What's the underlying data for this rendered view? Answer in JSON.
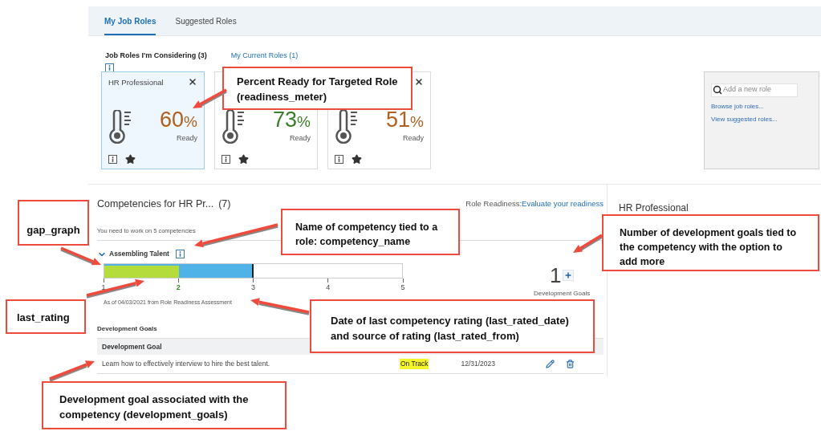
{
  "tabs": [
    {
      "label": "My Job Roles",
      "selected": true
    },
    {
      "label": "Suggested Roles",
      "selected": false
    }
  ],
  "role_lists": [
    {
      "label": "Job Roles I'm Considering (3)",
      "kind": "heading"
    },
    {
      "label": "My Current Roles (1)",
      "kind": "link"
    }
  ],
  "role_cards": [
    {
      "title": "HR Professional",
      "percent": "60",
      "unit": "%",
      "color": "#b0601c",
      "ready": "Ready",
      "selected": true
    },
    {
      "percent": "73",
      "unit": "%",
      "color": "#3b7d2a",
      "ready": "Ready",
      "selected": false
    },
    {
      "percent": "51",
      "unit": "%",
      "color": "#b0601c",
      "ready": "Ready",
      "selected": false
    }
  ],
  "side_panel": {
    "search": {
      "placeholder": "Add a new role"
    },
    "links": [
      "Browse job roles...",
      "View suggested roles..."
    ]
  },
  "competencies": {
    "title": "Competencies for HR Pr...",
    "count": "(7)",
    "readiness_label": "Role Readiness:",
    "readiness_link": "Evaluate your readiness",
    "subtitle": "You need to work on 5 competencies",
    "competency": {
      "name": "Assembling Talent",
      "expanded": true,
      "gap_graph": {
        "rating_bar": {
          "level": 0.25
        },
        "target_bar": {
          "level": 0.5
        },
        "ticks": [
          {
            "label": "1",
            "selected": false
          },
          {
            "label": "2",
            "selected": true
          },
          {
            "label": "3",
            "selected": false
          },
          {
            "label": "4",
            "selected": false
          },
          {
            "label": "5",
            "selected": false
          }
        ]
      },
      "goal_count": "1",
      "goal_count_label": "Development Goals",
      "rated_note": "As of 04/03/2021 from Role Readiness Assessment",
      "goals_heading": "Development Goals",
      "goals_table": {
        "columns": [
          "Development Goal"
        ],
        "rows": [
          {
            "goal": "Learn how to effectively interview to hire the best talent.",
            "status": "On Track",
            "due": "12/31/2023"
          }
        ]
      }
    }
  },
  "detail_panel": {
    "title": "HR Professional"
  },
  "annotations": [
    {
      "text": "Percent Ready for Targeted Role (readiness_meter)"
    },
    {
      "text": "gap_graph"
    },
    {
      "text": "Name of competency tied to a role: competency_name"
    },
    {
      "text": "Number of development goals tied to the competency with the option to add more"
    },
    {
      "text": "last_rating"
    },
    {
      "text": "Date of last competency rating (last_rated_date) and source of rating (last_rated_from)"
    },
    {
      "text": "Development goal associated with the competency (development_goals)"
    }
  ]
}
